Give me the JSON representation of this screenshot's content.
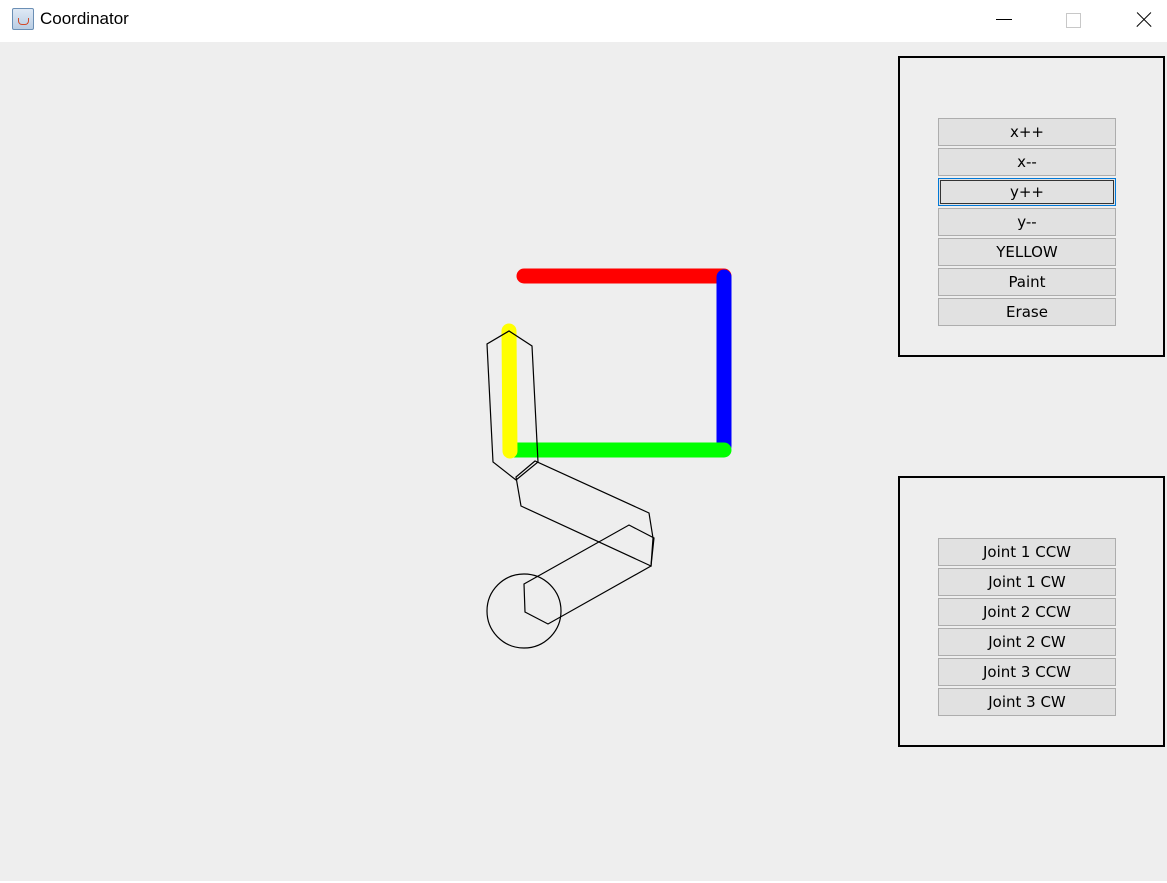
{
  "window": {
    "title": "Coordinator",
    "controls": [
      "minimize",
      "maximize",
      "close"
    ]
  },
  "icons": {
    "app": "java-coffee-cup-icon",
    "minimize": "minimize-icon",
    "maximize": "maximize-icon",
    "close": "close-icon"
  },
  "drawing": {
    "stroke_colors": {
      "top": "#ff0000",
      "right": "#0000ff",
      "bottom": "#00ff00",
      "left": "#ffff00"
    },
    "arm_outline_color": "#000000"
  },
  "position_panel": {
    "buttons": [
      {
        "label": "x++"
      },
      {
        "label": "x--"
      },
      {
        "label": "y++",
        "focused": true
      },
      {
        "label": "y--"
      },
      {
        "label": "YELLOW"
      },
      {
        "label": "Paint"
      },
      {
        "label": "Erase"
      }
    ]
  },
  "joint_panel": {
    "buttons": [
      {
        "label": "Joint 1 CCW"
      },
      {
        "label": "Joint 1 CW"
      },
      {
        "label": "Joint 2 CCW"
      },
      {
        "label": "Joint 2 CW"
      },
      {
        "label": "Joint 3 CCW"
      },
      {
        "label": "Joint 3 CW"
      }
    ]
  }
}
